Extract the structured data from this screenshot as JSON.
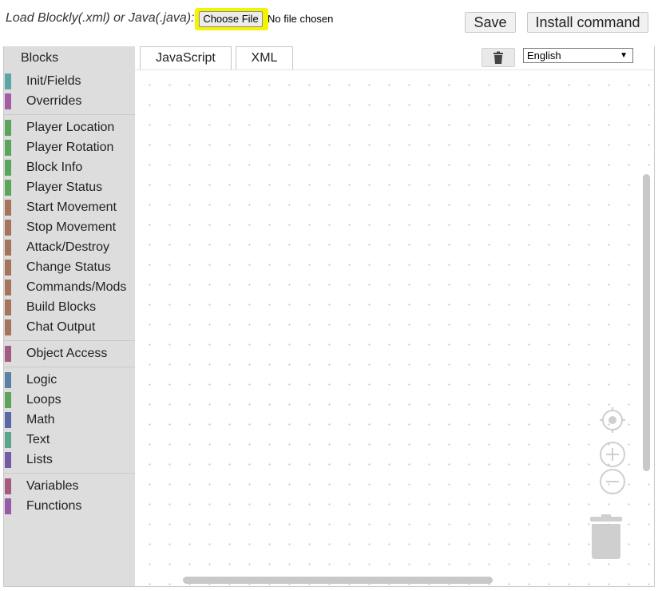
{
  "header": {
    "load_label": "Load Blockly(.xml) or Java(.java):",
    "choose_file_label": "Choose File",
    "no_file_text": "No file chosen",
    "save_label": "Save",
    "install_label": "Install command"
  },
  "tabs": [
    {
      "label": "JavaScript"
    },
    {
      "label": "XML"
    }
  ],
  "language": {
    "selected": "English"
  },
  "toolbox": {
    "title": "Blocks",
    "categories": [
      {
        "label": "Init/Fields",
        "color": "#5ba5a5"
      },
      {
        "label": "Overrides",
        "color": "#a55ba5"
      },
      {
        "label": "Player Location",
        "color": "#5ba55b"
      },
      {
        "label": "Player Rotation",
        "color": "#5ba55b"
      },
      {
        "label": "Block Info",
        "color": "#5ba55b"
      },
      {
        "label": "Player Status",
        "color": "#5ba55b"
      },
      {
        "label": "Start Movement",
        "color": "#a5745b"
      },
      {
        "label": "Stop Movement",
        "color": "#a5745b"
      },
      {
        "label": "Attack/Destroy",
        "color": "#a5745b"
      },
      {
        "label": "Change Status",
        "color": "#a5745b"
      },
      {
        "label": "Commands/Mods",
        "color": "#a5745b"
      },
      {
        "label": "Build Blocks",
        "color": "#a5745b"
      },
      {
        "label": "Chat Output",
        "color": "#a5745b"
      },
      {
        "label": "Object Access",
        "color": "#a55b80"
      },
      {
        "label": "Logic",
        "color": "#5b80a5"
      },
      {
        "label": "Loops",
        "color": "#5ba55b"
      },
      {
        "label": "Math",
        "color": "#5b67a5"
      },
      {
        "label": "Text",
        "color": "#5ba58c"
      },
      {
        "label": "Lists",
        "color": "#745ba5"
      },
      {
        "label": "Variables",
        "color": "#a55b80"
      },
      {
        "label": "Functions",
        "color": "#995ba5"
      }
    ]
  },
  "colors": {
    "highlight": "#f4f400",
    "toolbox_bg": "#dddddd",
    "scrollbar": "#c8c8c8"
  },
  "icons": {
    "trash_button": "trash-icon",
    "recenter": "recenter-icon",
    "zoom_in": "zoom-in-icon",
    "zoom_out": "zoom-out-icon",
    "workspace_trash": "trashcan-icon"
  }
}
